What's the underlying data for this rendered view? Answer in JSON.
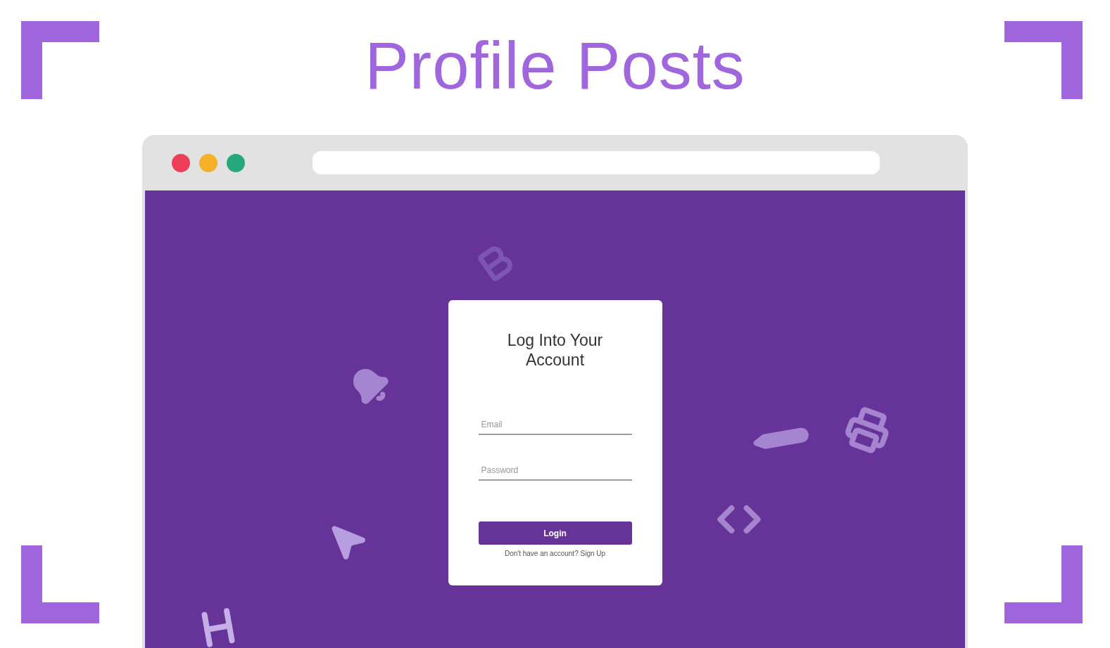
{
  "title": "Profile Posts",
  "browser": {
    "dots": [
      {
        "color": "#ee3f58"
      },
      {
        "color": "#f6b12a"
      },
      {
        "color": "#26a87a"
      }
    ]
  },
  "login": {
    "heading": "Log Into Your Account",
    "fields": [
      {
        "placeholder": "Email"
      },
      {
        "placeholder": "Password"
      }
    ],
    "button": "Login",
    "footer": {
      "text": "Don't have an account?",
      "link": "Sign Up"
    }
  }
}
